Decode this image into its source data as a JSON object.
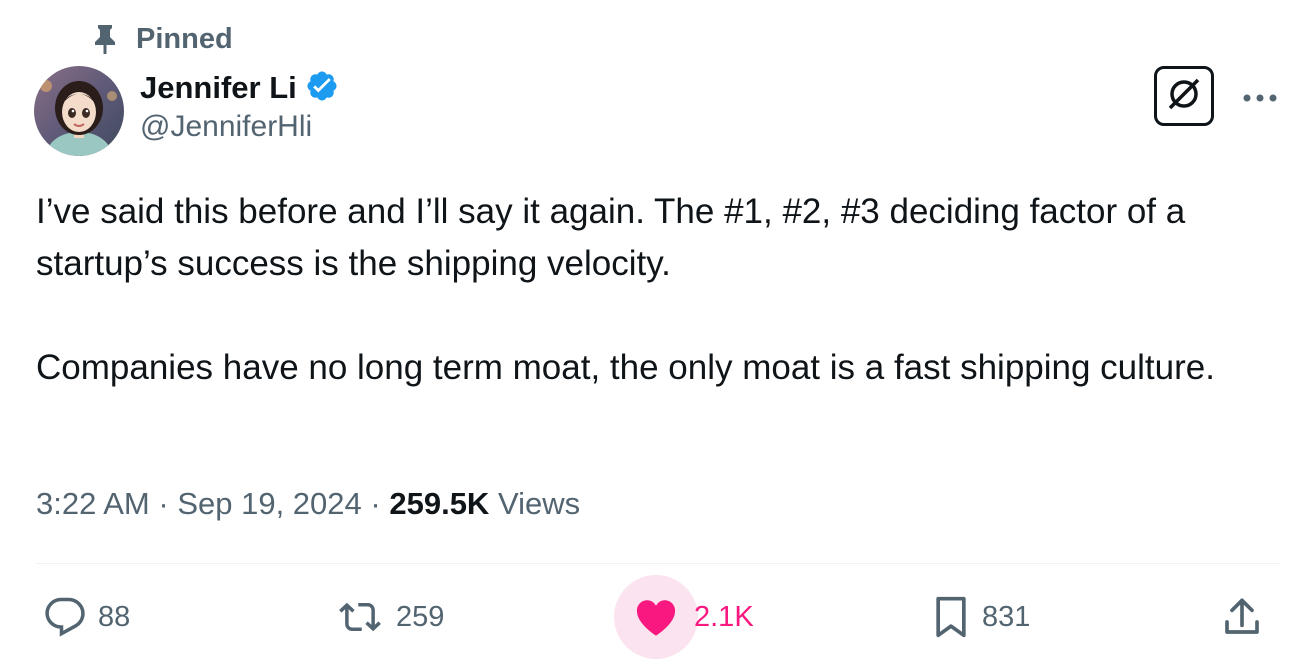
{
  "pinned": {
    "label": "Pinned",
    "icon": "pin-icon"
  },
  "author": {
    "name": "Jennifer Li",
    "handle": "@JenniferHli",
    "verified": true,
    "verified_color": "#1d9bf0"
  },
  "tweet": {
    "paragraphs": [
      "I’ve said this before and I’ll say it again. The #1, #2, #3 deciding factor of a startup’s success is the shipping velocity.",
      "Companies have no long term moat, the only moat is a fast shipping culture."
    ]
  },
  "meta": {
    "time": "3:22 AM",
    "separator": "·",
    "date": "Sep 19, 2024",
    "views_count": "259.5K",
    "views_label": "Views"
  },
  "actions": {
    "reply": {
      "icon": "reply-icon",
      "count": "88"
    },
    "retweet": {
      "icon": "retweet-icon",
      "count": "259"
    },
    "like": {
      "icon": "heart-icon",
      "count": "2.1K",
      "active": true,
      "color": "#f91880"
    },
    "bookmark": {
      "icon": "bookmark-icon",
      "count": "831"
    },
    "share": {
      "icon": "share-icon"
    }
  },
  "toolbar": {
    "grok_icon": "grok-icon",
    "more_icon": "more-icon"
  },
  "colors": {
    "text_primary": "#0f1419",
    "text_secondary": "#536471",
    "accent_like": "#f91880",
    "verified_blue": "#1d9bf0"
  }
}
